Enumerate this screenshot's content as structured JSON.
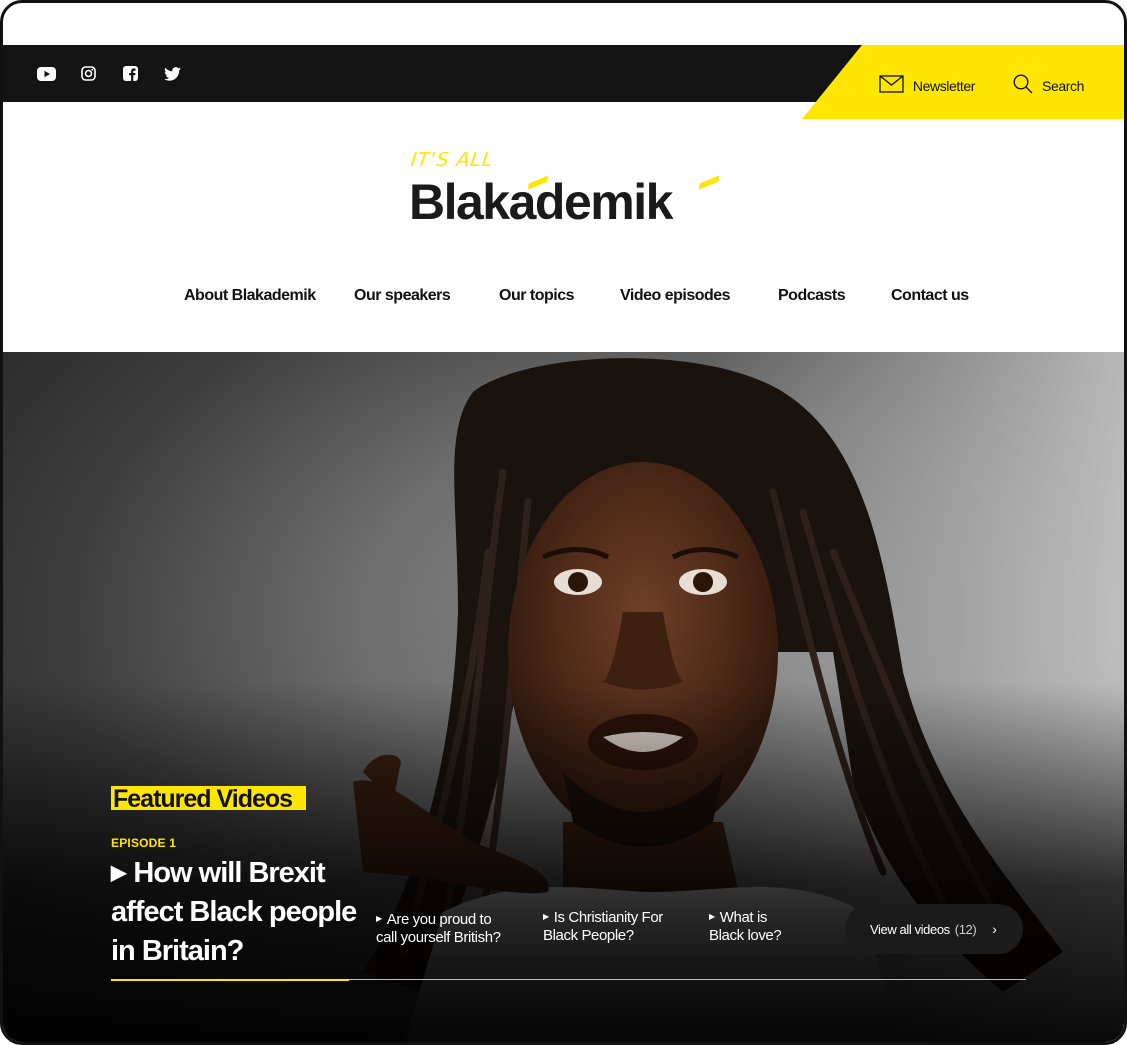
{
  "topbar": {
    "socials": [
      {
        "name": "youtube-icon"
      },
      {
        "name": "instagram-icon"
      },
      {
        "name": "facebook-icon"
      },
      {
        "name": "twitter-icon"
      }
    ],
    "newsletter_label": "Newsletter",
    "search_label": "Search",
    "accent_color": "#ffe600"
  },
  "logo": {
    "small_text": "IT'S ALL",
    "main_text": "Blakademik"
  },
  "nav": {
    "items": [
      {
        "label": "About Blakademik"
      },
      {
        "label": "Our speakers"
      },
      {
        "label": "Our topics"
      },
      {
        "label": "Video episodes"
      },
      {
        "label": "Podcasts"
      },
      {
        "label": "Contact us"
      }
    ]
  },
  "hero": {
    "section_label": "Featured Videos",
    "episode_tag": "EPISODE 1",
    "main_title": "How will Brexit affect Black people in Britain?",
    "videos": [
      {
        "title": "Are you proud to call yourself British?"
      },
      {
        "title": "Is Christianity For Black People?"
      },
      {
        "title": "What is Black love?"
      }
    ],
    "view_all_label": "View all videos",
    "view_all_count": "(12)"
  }
}
